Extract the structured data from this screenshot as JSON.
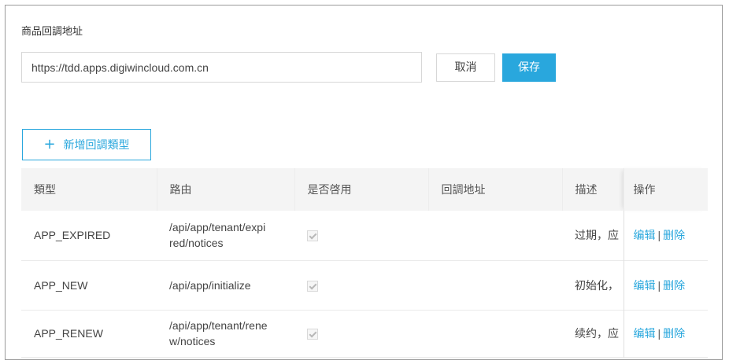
{
  "callback": {
    "title": "商品回調地址",
    "url_value": "https://tdd.apps.digiwincloud.com.cn",
    "cancel_label": "取消",
    "save_label": "保存"
  },
  "add_button": {
    "icon": "plus-icon",
    "plus": "+",
    "label": "新增回調類型"
  },
  "table": {
    "headers": [
      "類型",
      "路由",
      "是否啓用",
      "回調地址",
      "描述",
      "操作"
    ],
    "rows": [
      {
        "type": "APP_EXPIRED",
        "route": "/api/app/tenant/expired/notices",
        "route_l1": "/api/app/tenant/expi",
        "route_l2": "red/notices",
        "enabled": true,
        "callback_url": "",
        "desc": "过期，应",
        "edit": "编辑",
        "sep": "|",
        "delete": "删除"
      },
      {
        "type": "APP_NEW",
        "route": "/api/app/initialize",
        "route_l1": "/api/app/initialize",
        "route_l2": "",
        "enabled": true,
        "callback_url": "",
        "desc": "初始化，",
        "edit": "编辑",
        "sep": "|",
        "delete": "删除"
      },
      {
        "type": "APP_RENEW",
        "route": "/api/app/tenant/renew/notices",
        "route_l1": "/api/app/tenant/rene",
        "route_l2": "w/notices",
        "enabled": true,
        "callback_url": "",
        "desc": "续约，应",
        "edit": "编辑",
        "sep": "|",
        "delete": "删除"
      }
    ]
  },
  "colors": {
    "accent": "#29a7dd",
    "border": "#d7d7d7",
    "header_bg": "#f4f4f4"
  }
}
